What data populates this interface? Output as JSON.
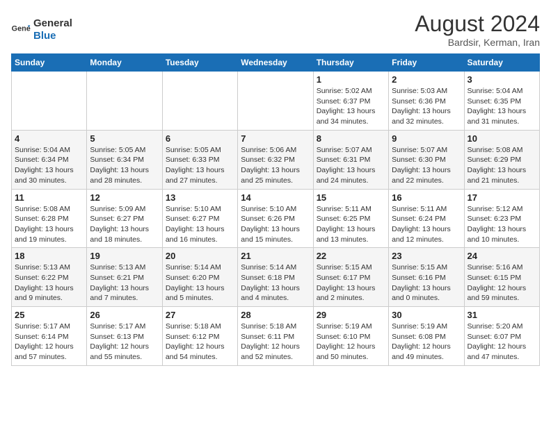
{
  "header": {
    "logo_general": "General",
    "logo_blue": "Blue",
    "month_title": "August 2024",
    "location": "Bardsir, Kerman, Iran"
  },
  "weekdays": [
    "Sunday",
    "Monday",
    "Tuesday",
    "Wednesday",
    "Thursday",
    "Friday",
    "Saturday"
  ],
  "weeks": [
    [
      {
        "num": "",
        "text": ""
      },
      {
        "num": "",
        "text": ""
      },
      {
        "num": "",
        "text": ""
      },
      {
        "num": "",
        "text": ""
      },
      {
        "num": "1",
        "text": "Sunrise: 5:02 AM\nSunset: 6:37 PM\nDaylight: 13 hours and 34 minutes."
      },
      {
        "num": "2",
        "text": "Sunrise: 5:03 AM\nSunset: 6:36 PM\nDaylight: 13 hours and 32 minutes."
      },
      {
        "num": "3",
        "text": "Sunrise: 5:04 AM\nSunset: 6:35 PM\nDaylight: 13 hours and 31 minutes."
      }
    ],
    [
      {
        "num": "4",
        "text": "Sunrise: 5:04 AM\nSunset: 6:34 PM\nDaylight: 13 hours and 30 minutes."
      },
      {
        "num": "5",
        "text": "Sunrise: 5:05 AM\nSunset: 6:34 PM\nDaylight: 13 hours and 28 minutes."
      },
      {
        "num": "6",
        "text": "Sunrise: 5:05 AM\nSunset: 6:33 PM\nDaylight: 13 hours and 27 minutes."
      },
      {
        "num": "7",
        "text": "Sunrise: 5:06 AM\nSunset: 6:32 PM\nDaylight: 13 hours and 25 minutes."
      },
      {
        "num": "8",
        "text": "Sunrise: 5:07 AM\nSunset: 6:31 PM\nDaylight: 13 hours and 24 minutes."
      },
      {
        "num": "9",
        "text": "Sunrise: 5:07 AM\nSunset: 6:30 PM\nDaylight: 13 hours and 22 minutes."
      },
      {
        "num": "10",
        "text": "Sunrise: 5:08 AM\nSunset: 6:29 PM\nDaylight: 13 hours and 21 minutes."
      }
    ],
    [
      {
        "num": "11",
        "text": "Sunrise: 5:08 AM\nSunset: 6:28 PM\nDaylight: 13 hours and 19 minutes."
      },
      {
        "num": "12",
        "text": "Sunrise: 5:09 AM\nSunset: 6:27 PM\nDaylight: 13 hours and 18 minutes."
      },
      {
        "num": "13",
        "text": "Sunrise: 5:10 AM\nSunset: 6:27 PM\nDaylight: 13 hours and 16 minutes."
      },
      {
        "num": "14",
        "text": "Sunrise: 5:10 AM\nSunset: 6:26 PM\nDaylight: 13 hours and 15 minutes."
      },
      {
        "num": "15",
        "text": "Sunrise: 5:11 AM\nSunset: 6:25 PM\nDaylight: 13 hours and 13 minutes."
      },
      {
        "num": "16",
        "text": "Sunrise: 5:11 AM\nSunset: 6:24 PM\nDaylight: 13 hours and 12 minutes."
      },
      {
        "num": "17",
        "text": "Sunrise: 5:12 AM\nSunset: 6:23 PM\nDaylight: 13 hours and 10 minutes."
      }
    ],
    [
      {
        "num": "18",
        "text": "Sunrise: 5:13 AM\nSunset: 6:22 PM\nDaylight: 13 hours and 9 minutes."
      },
      {
        "num": "19",
        "text": "Sunrise: 5:13 AM\nSunset: 6:21 PM\nDaylight: 13 hours and 7 minutes."
      },
      {
        "num": "20",
        "text": "Sunrise: 5:14 AM\nSunset: 6:20 PM\nDaylight: 13 hours and 5 minutes."
      },
      {
        "num": "21",
        "text": "Sunrise: 5:14 AM\nSunset: 6:18 PM\nDaylight: 13 hours and 4 minutes."
      },
      {
        "num": "22",
        "text": "Sunrise: 5:15 AM\nSunset: 6:17 PM\nDaylight: 13 hours and 2 minutes."
      },
      {
        "num": "23",
        "text": "Sunrise: 5:15 AM\nSunset: 6:16 PM\nDaylight: 13 hours and 0 minutes."
      },
      {
        "num": "24",
        "text": "Sunrise: 5:16 AM\nSunset: 6:15 PM\nDaylight: 12 hours and 59 minutes."
      }
    ],
    [
      {
        "num": "25",
        "text": "Sunrise: 5:17 AM\nSunset: 6:14 PM\nDaylight: 12 hours and 57 minutes."
      },
      {
        "num": "26",
        "text": "Sunrise: 5:17 AM\nSunset: 6:13 PM\nDaylight: 12 hours and 55 minutes."
      },
      {
        "num": "27",
        "text": "Sunrise: 5:18 AM\nSunset: 6:12 PM\nDaylight: 12 hours and 54 minutes."
      },
      {
        "num": "28",
        "text": "Sunrise: 5:18 AM\nSunset: 6:11 PM\nDaylight: 12 hours and 52 minutes."
      },
      {
        "num": "29",
        "text": "Sunrise: 5:19 AM\nSunset: 6:10 PM\nDaylight: 12 hours and 50 minutes."
      },
      {
        "num": "30",
        "text": "Sunrise: 5:19 AM\nSunset: 6:08 PM\nDaylight: 12 hours and 49 minutes."
      },
      {
        "num": "31",
        "text": "Sunrise: 5:20 AM\nSunset: 6:07 PM\nDaylight: 12 hours and 47 minutes."
      }
    ]
  ]
}
